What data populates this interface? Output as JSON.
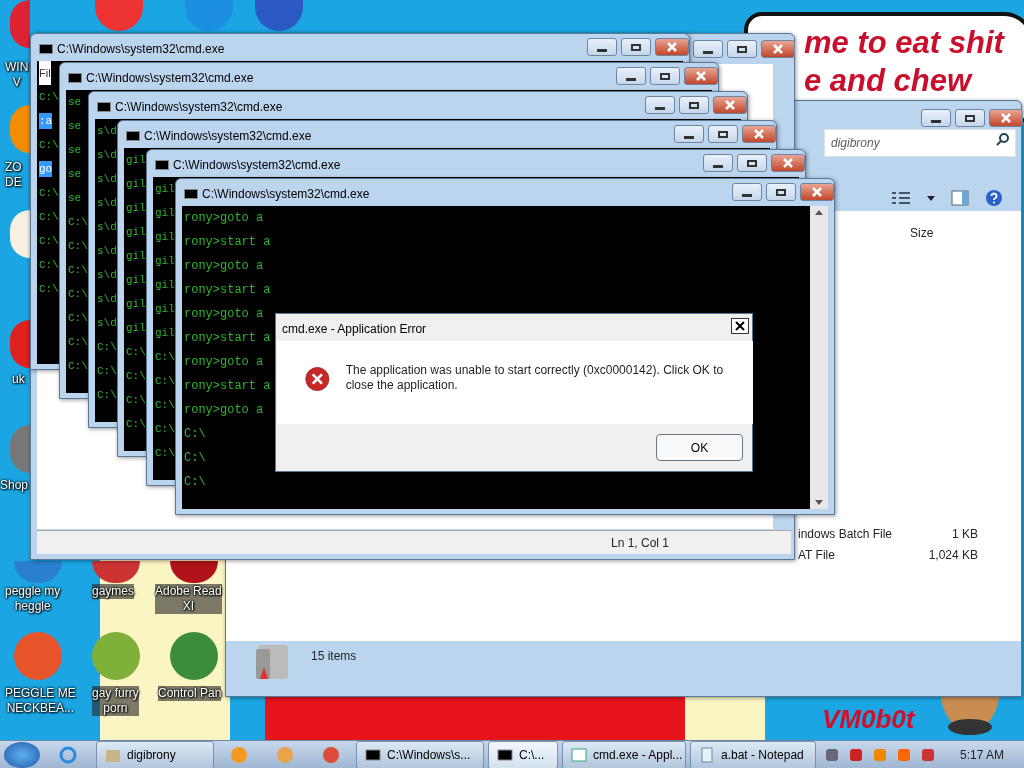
{
  "wallpaper": {
    "bubble_lines": [
      "me to eat shit",
      "e and chew"
    ],
    "signature": "VM0b0t"
  },
  "desktop_icons": [
    {
      "label": [
        "WIN",
        "V"
      ]
    },
    {
      "label": [
        "ZO",
        "DE"
      ]
    },
    {
      "label": [
        "uk"
      ]
    },
    {
      "label": [
        "Shop"
      ]
    },
    {
      "label": [
        "peggle my",
        "heggle"
      ]
    },
    {
      "label": [
        "gaymes"
      ]
    },
    {
      "label": [
        "Adobe Read",
        "XI"
      ]
    },
    {
      "label": [
        "PEGGLE ME",
        "NECKBEA..."
      ]
    },
    {
      "label": [
        "gay furry",
        "porn"
      ]
    },
    {
      "label": [
        "Control Pan"
      ]
    }
  ],
  "explorer": {
    "search": {
      "placeholder": "digibrony"
    },
    "columns": [
      "Size"
    ],
    "rows": [
      {
        "type": "indows Batch File",
        "size": "1 KB"
      },
      {
        "type": "AT File",
        "size": "1,024 KB"
      }
    ],
    "status": "15 items"
  },
  "notepad": {
    "status": "Ln 1, Col 1"
  },
  "cmd_windows": [
    {
      "title": "C:\\Windows\\system32\\cmd.exe",
      "lines": [
        {
          "text": "Fil",
          "kind": "menu"
        },
        {
          "text": "C:\\",
          "kind": "console"
        },
        {
          "text": ":a",
          "kind": "selected"
        },
        {
          "text": "C:\\",
          "kind": "console"
        },
        {
          "text": "go",
          "kind": "selected"
        },
        {
          "text": "C:\\",
          "kind": "console"
        },
        {
          "text": "C:\\",
          "kind": "console"
        },
        {
          "text": "C:\\",
          "kind": "console"
        },
        {
          "text": "C:\\",
          "kind": "console"
        },
        {
          "text": "C:\\",
          "kind": "console"
        }
      ]
    },
    {
      "title": "C:\\Windows\\system32\\cmd.exe",
      "lines": [
        {
          "text": "se",
          "kind": "console"
        },
        {
          "text": "se",
          "kind": "console"
        },
        {
          "text": "se",
          "kind": "console"
        },
        {
          "text": "se",
          "kind": "console"
        },
        {
          "text": "se",
          "kind": "console"
        },
        {
          "text": "C:\\",
          "kind": "console"
        },
        {
          "text": "C:\\",
          "kind": "console"
        },
        {
          "text": "C:\\",
          "kind": "console"
        },
        {
          "text": "C:\\",
          "kind": "console"
        },
        {
          "text": "C:\\",
          "kind": "console"
        },
        {
          "text": "C:\\",
          "kind": "console"
        },
        {
          "text": "C:\\",
          "kind": "console"
        }
      ]
    },
    {
      "title": "C:\\Windows\\system32\\cmd.exe",
      "lines": [
        {
          "text": "s\\d",
          "kind": "console"
        },
        {
          "text": "s\\d",
          "kind": "console"
        },
        {
          "text": "s\\d",
          "kind": "console"
        },
        {
          "text": "s\\d",
          "kind": "console"
        },
        {
          "text": "s\\d",
          "kind": "console"
        },
        {
          "text": "s\\d",
          "kind": "console"
        },
        {
          "text": "s\\d",
          "kind": "console"
        },
        {
          "text": "s\\d",
          "kind": "console"
        },
        {
          "text": "s\\d",
          "kind": "console"
        },
        {
          "text": "C:\\",
          "kind": "console"
        },
        {
          "text": "C:\\",
          "kind": "console"
        },
        {
          "text": "C:\\",
          "kind": "console"
        }
      ]
    },
    {
      "title": "C:\\Windows\\system32\\cmd.exe",
      "lines": [
        {
          "text": "gil",
          "kind": "console"
        },
        {
          "text": "gil",
          "kind": "console"
        },
        {
          "text": "gil",
          "kind": "console"
        },
        {
          "text": "gil",
          "kind": "console"
        },
        {
          "text": "gil",
          "kind": "console"
        },
        {
          "text": "gil",
          "kind": "console"
        },
        {
          "text": "gil",
          "kind": "console"
        },
        {
          "text": "gil",
          "kind": "console"
        },
        {
          "text": "C:\\",
          "kind": "console"
        },
        {
          "text": "C:\\",
          "kind": "console"
        },
        {
          "text": "C:\\",
          "kind": "console"
        },
        {
          "text": "C:\\",
          "kind": "console"
        }
      ]
    },
    {
      "title": "C:\\Windows\\system32\\cmd.exe",
      "lines": [
        {
          "text": "gil",
          "kind": "console"
        },
        {
          "text": "gil",
          "kind": "console"
        },
        {
          "text": "gil",
          "kind": "console"
        },
        {
          "text": "gil",
          "kind": "console"
        },
        {
          "text": "gil",
          "kind": "console"
        },
        {
          "text": "gil",
          "kind": "console"
        },
        {
          "text": "gil",
          "kind": "console"
        },
        {
          "text": "C:\\",
          "kind": "console"
        },
        {
          "text": "C:\\",
          "kind": "console"
        },
        {
          "text": "C:\\",
          "kind": "console"
        },
        {
          "text": "C:\\",
          "kind": "console"
        },
        {
          "text": "C:\\",
          "kind": "console"
        }
      ]
    },
    {
      "title": "C:\\Windows\\system32\\cmd.exe",
      "lines": [
        {
          "text": "rony>goto a",
          "kind": "console"
        },
        {
          "text": "rony>start a",
          "kind": "console"
        },
        {
          "text": "rony>goto a",
          "kind": "console"
        },
        {
          "text": "rony>start a",
          "kind": "console"
        },
        {
          "text": "rony>goto a",
          "kind": "console"
        },
        {
          "text": "rony>start a",
          "kind": "console"
        },
        {
          "text": "rony>goto a",
          "kind": "console"
        },
        {
          "text": "rony>start a",
          "kind": "console"
        },
        {
          "text": "rony>goto a",
          "kind": "console"
        },
        {
          "text": "C:\\",
          "kind": "console"
        },
        {
          "text": "C:\\",
          "kind": "console"
        },
        {
          "text": "C:\\",
          "kind": "console"
        }
      ]
    }
  ],
  "dialog": {
    "title": "cmd.exe - Application Error",
    "message": "The application was unable to start correctly (0xc0000142). Click OK to close the application.",
    "button": "OK"
  },
  "taskbar": {
    "buttons": [
      {
        "label": "digibrony",
        "kind": "folder",
        "selected": false
      },
      {
        "label": "C:\\Windows\\s...",
        "kind": "console",
        "selected": false
      },
      {
        "label": "C:\\...",
        "kind": "console",
        "selected": true
      },
      {
        "label": "cmd.exe - Appl...",
        "kind": "app",
        "selected": false
      },
      {
        "label": "a.bat - Notepad",
        "kind": "notepad",
        "selected": false
      }
    ],
    "clock": "5:17 AM"
  }
}
